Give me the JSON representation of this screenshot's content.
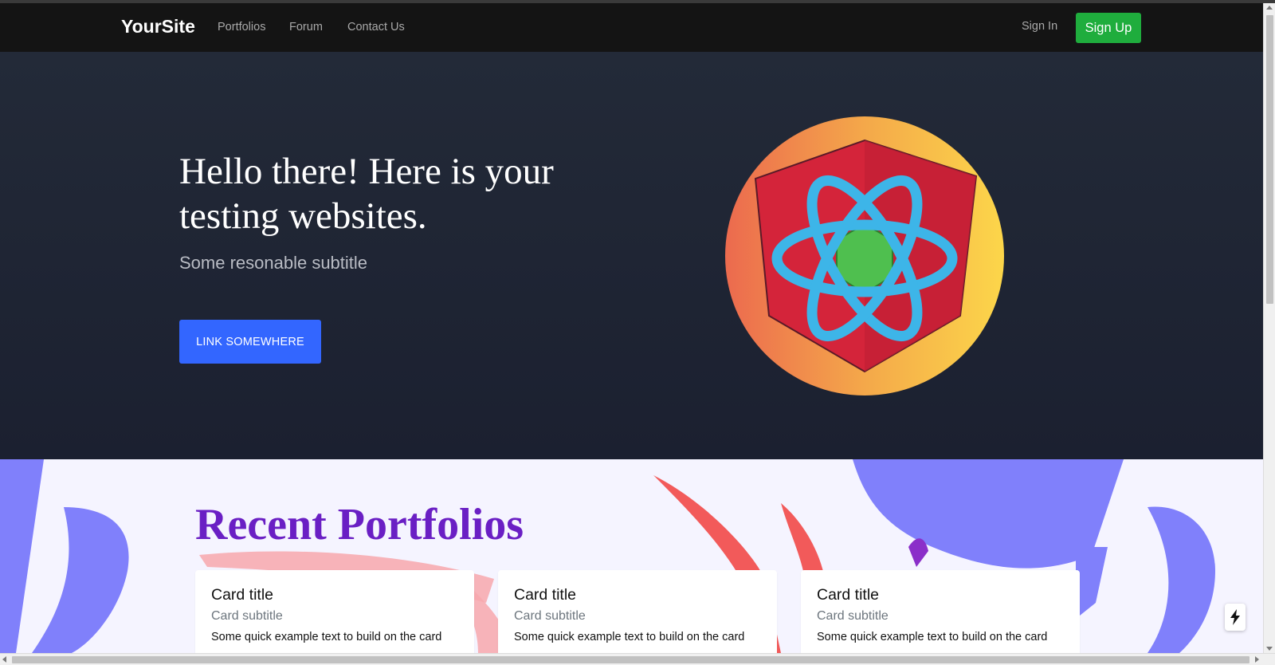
{
  "navbar": {
    "brand": "YourSite",
    "links": [
      "Portfolios",
      "Forum",
      "Contact Us"
    ],
    "sign_in": "Sign In",
    "sign_up": "Sign Up"
  },
  "hero": {
    "title": "Hello there! Here is your testing websites.",
    "subtitle": "Some resonable subtitle",
    "cta_label": "LINK SOMEWHERE"
  },
  "portfolios": {
    "title": "Recent Portfolios",
    "cards": [
      {
        "title": "Card title",
        "subtitle": "Card subtitle",
        "text": "Some quick example text to build on the card"
      },
      {
        "title": "Card title",
        "subtitle": "Card subtitle",
        "text": "Some quick example text to build on the card"
      },
      {
        "title": "Card title",
        "subtitle": "Card subtitle",
        "text": "Some quick example text to build on the card"
      }
    ]
  },
  "icons": {
    "hero_logo": "atom-shield-logo",
    "floating_button": "flash-icon"
  },
  "colors": {
    "navbar_bg": "#141414",
    "hero_bg": "#1d2230",
    "signup_green": "#1fad3d",
    "cta_blue": "#3366ff",
    "section_title_purple": "#6a1fc4",
    "section_bg": "#f5f4ff"
  }
}
